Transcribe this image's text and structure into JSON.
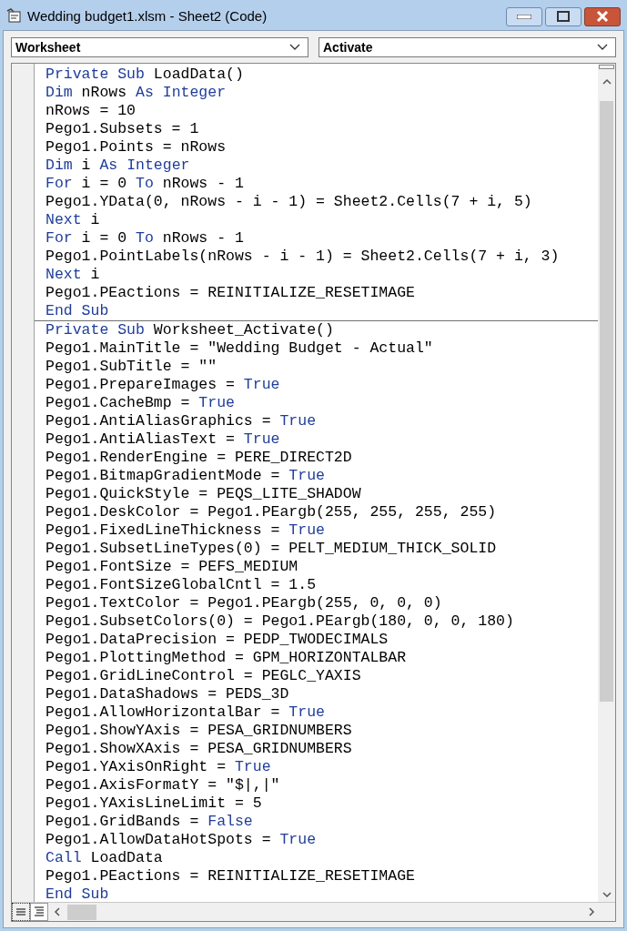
{
  "window": {
    "title": "Wedding budget1.xlsm - Sheet2 (Code)"
  },
  "object_dropdown": {
    "value": "Worksheet"
  },
  "procedure_dropdown": {
    "value": "Activate"
  },
  "procedures": [
    {
      "lines": [
        [
          {
            "text": "Private Sub",
            "kind": "keyword"
          },
          {
            "text": " LoadData()",
            "kind": "plain"
          }
        ],
        [
          {
            "text": "Dim",
            "kind": "keyword"
          },
          {
            "text": " nRows ",
            "kind": "plain"
          },
          {
            "text": "As Integer",
            "kind": "keyword"
          }
        ],
        [
          {
            "text": "nRows = 10",
            "kind": "plain"
          }
        ],
        [
          {
            "text": "Pego1.Subsets = 1",
            "kind": "plain"
          }
        ],
        [
          {
            "text": "Pego1.Points = nRows",
            "kind": "plain"
          }
        ],
        [
          {
            "text": "Dim",
            "kind": "keyword"
          },
          {
            "text": " i ",
            "kind": "plain"
          },
          {
            "text": "As Integer",
            "kind": "keyword"
          }
        ],
        [
          {
            "text": "For",
            "kind": "keyword"
          },
          {
            "text": " i = 0 ",
            "kind": "plain"
          },
          {
            "text": "To",
            "kind": "keyword"
          },
          {
            "text": " nRows - 1",
            "kind": "plain"
          }
        ],
        [
          {
            "text": "Pego1.YData(0, nRows - i - 1) = Sheet2.Cells(7 + i, 5)",
            "kind": "plain"
          }
        ],
        [
          {
            "text": "Next",
            "kind": "keyword"
          },
          {
            "text": " i",
            "kind": "plain"
          }
        ],
        [
          {
            "text": "For",
            "kind": "keyword"
          },
          {
            "text": " i = 0 ",
            "kind": "plain"
          },
          {
            "text": "To",
            "kind": "keyword"
          },
          {
            "text": " nRows - 1",
            "kind": "plain"
          }
        ],
        [
          {
            "text": "Pego1.PointLabels(nRows - i - 1) = Sheet2.Cells(7 + i, 3)",
            "kind": "plain"
          }
        ],
        [
          {
            "text": "Next",
            "kind": "keyword"
          },
          {
            "text": " i",
            "kind": "plain"
          }
        ],
        [
          {
            "text": "Pego1.PEactions = REINITIALIZE_RESETIMAGE",
            "kind": "plain"
          }
        ],
        [
          {
            "text": "End Sub",
            "kind": "keyword"
          }
        ]
      ]
    },
    {
      "lines": [
        [
          {
            "text": "Private Sub",
            "kind": "keyword"
          },
          {
            "text": " Worksheet_Activate()",
            "kind": "plain"
          }
        ],
        [
          {
            "text": "Pego1.MainTitle = \"Wedding Budget - Actual\"",
            "kind": "plain"
          }
        ],
        [
          {
            "text": "Pego1.SubTitle = \"\"",
            "kind": "plain"
          }
        ],
        [
          {
            "text": "Pego1.PrepareImages = ",
            "kind": "plain"
          },
          {
            "text": "True",
            "kind": "keyword"
          }
        ],
        [
          {
            "text": "Pego1.CacheBmp = ",
            "kind": "plain"
          },
          {
            "text": "True",
            "kind": "keyword"
          }
        ],
        [
          {
            "text": "Pego1.AntiAliasGraphics = ",
            "kind": "plain"
          },
          {
            "text": "True",
            "kind": "keyword"
          }
        ],
        [
          {
            "text": "Pego1.AntiAliasText = ",
            "kind": "plain"
          },
          {
            "text": "True",
            "kind": "keyword"
          }
        ],
        [
          {
            "text": "Pego1.RenderEngine = PERE_DIRECT2D",
            "kind": "plain"
          }
        ],
        [
          {
            "text": "Pego1.BitmapGradientMode = ",
            "kind": "plain"
          },
          {
            "text": "True",
            "kind": "keyword"
          }
        ],
        [
          {
            "text": "Pego1.QuickStyle = PEQS_LITE_SHADOW",
            "kind": "plain"
          }
        ],
        [
          {
            "text": "Pego1.DeskColor = Pego1.PEargb(255, 255, 255, 255)",
            "kind": "plain"
          }
        ],
        [
          {
            "text": "Pego1.FixedLineThickness = ",
            "kind": "plain"
          },
          {
            "text": "True",
            "kind": "keyword"
          }
        ],
        [
          {
            "text": "Pego1.SubsetLineTypes(0) = PELT_MEDIUM_THICK_SOLID",
            "kind": "plain"
          }
        ],
        [
          {
            "text": "Pego1.FontSize = PEFS_MEDIUM",
            "kind": "plain"
          }
        ],
        [
          {
            "text": "Pego1.FontSizeGlobalCntl = 1.5",
            "kind": "plain"
          }
        ],
        [
          {
            "text": "Pego1.TextColor = Pego1.PEargb(255, 0, 0, 0)",
            "kind": "plain"
          }
        ],
        [
          {
            "text": "Pego1.SubsetColors(0) = Pego1.PEargb(180, 0, 0, 180)",
            "kind": "plain"
          }
        ],
        [
          {
            "text": "Pego1.DataPrecision = PEDP_TWODECIMALS",
            "kind": "plain"
          }
        ],
        [
          {
            "text": "Pego1.PlottingMethod = GPM_HORIZONTALBAR",
            "kind": "plain"
          }
        ],
        [
          {
            "text": "Pego1.GridLineControl = PEGLC_YAXIS",
            "kind": "plain"
          }
        ],
        [
          {
            "text": "Pego1.DataShadows = PEDS_3D",
            "kind": "plain"
          }
        ],
        [
          {
            "text": "Pego1.AllowHorizontalBar = ",
            "kind": "plain"
          },
          {
            "text": "True",
            "kind": "keyword"
          }
        ],
        [
          {
            "text": "Pego1.ShowYAxis = PESA_GRIDNUMBERS",
            "kind": "plain"
          }
        ],
        [
          {
            "text": "Pego1.ShowXAxis = PESA_GRIDNUMBERS",
            "kind": "plain"
          }
        ],
        [
          {
            "text": "Pego1.YAxisOnRight = ",
            "kind": "plain"
          },
          {
            "text": "True",
            "kind": "keyword"
          }
        ],
        [
          {
            "text": "Pego1.AxisFormatY = \"$|,|\"",
            "kind": "plain"
          }
        ],
        [
          {
            "text": "Pego1.YAxisLineLimit = 5",
            "kind": "plain"
          }
        ],
        [
          {
            "text": "Pego1.GridBands = ",
            "kind": "plain"
          },
          {
            "text": "False",
            "kind": "keyword"
          }
        ],
        [
          {
            "text": "Pego1.AllowDataHotSpots = ",
            "kind": "plain"
          },
          {
            "text": "True",
            "kind": "keyword"
          }
        ],
        [
          {
            "text": "Call",
            "kind": "keyword"
          },
          {
            "text": " LoadData",
            "kind": "plain"
          }
        ],
        [
          {
            "text": "Pego1.PEactions = REINITIALIZE_RESETIMAGE",
            "kind": "plain"
          }
        ],
        [
          {
            "text": "End Sub",
            "kind": "keyword"
          }
        ]
      ]
    }
  ]
}
